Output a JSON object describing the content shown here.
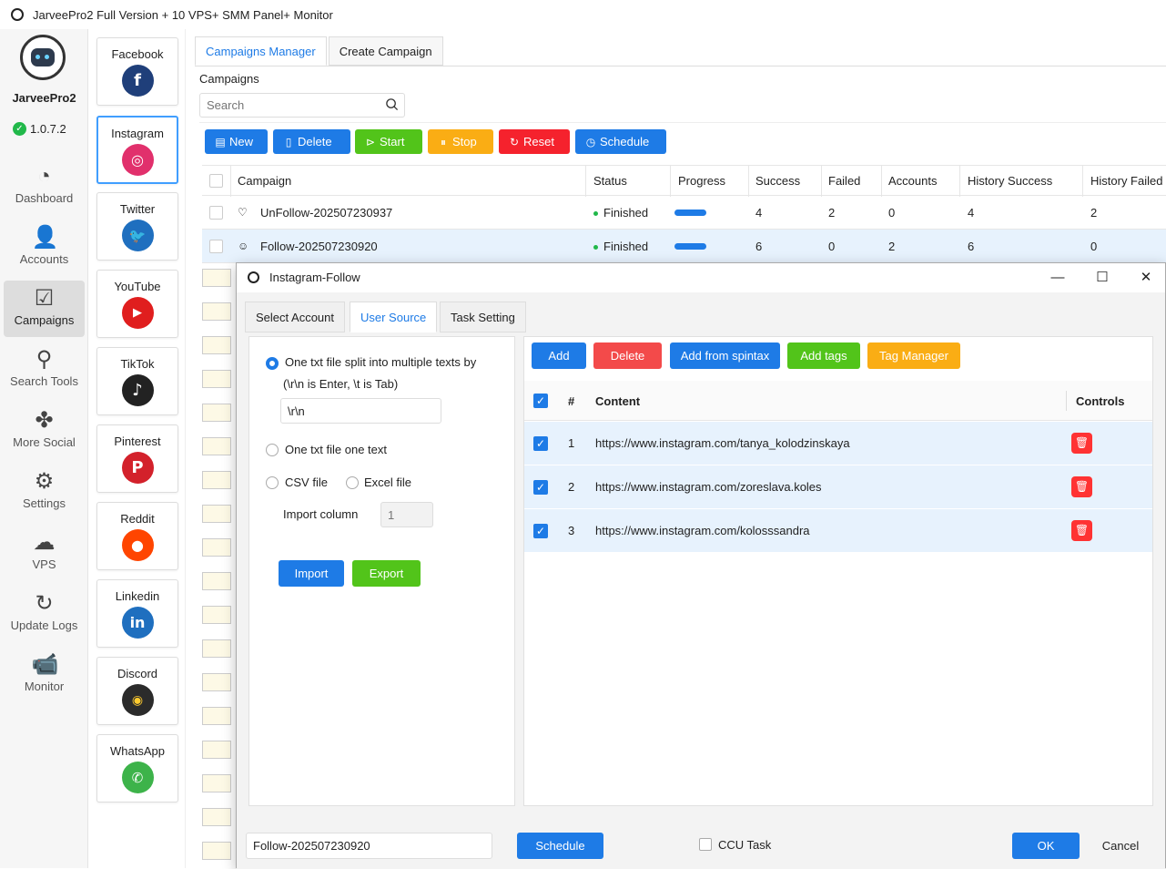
{
  "window": {
    "title": "JarveePro2 Full Version + 10 VPS+ SMM Panel+ Monitor"
  },
  "sidebar": {
    "brand": "JarveePro2",
    "version": "1.0.7.2",
    "items": [
      {
        "label": "Dashboard",
        "icon": "dashboard-icon"
      },
      {
        "label": "Accounts",
        "icon": "accounts-icon"
      },
      {
        "label": "Campaigns",
        "icon": "campaigns-icon",
        "active": true
      },
      {
        "label": "Search Tools",
        "icon": "search-tools-icon"
      },
      {
        "label": "More Social",
        "icon": "more-social-icon"
      },
      {
        "label": "Settings",
        "icon": "gear-icon"
      },
      {
        "label": "VPS",
        "icon": "vps-icon"
      },
      {
        "label": "Update Logs",
        "icon": "update-logs-icon"
      },
      {
        "label": "Monitor",
        "icon": "monitor-icon"
      }
    ]
  },
  "social": [
    {
      "label": "Facebook",
      "icon": "facebook-icon",
      "color": "#1f3f7a"
    },
    {
      "label": "Instagram",
      "icon": "instagram-icon",
      "color": "#e1306c",
      "active": true
    },
    {
      "label": "Twitter",
      "icon": "twitter-icon",
      "color": "#1f6fbf"
    },
    {
      "label": "YouTube",
      "icon": "youtube-icon",
      "color": "#e01e1e"
    },
    {
      "label": "TikTok",
      "icon": "tiktok-icon",
      "color": "#222222"
    },
    {
      "label": "Pinterest",
      "icon": "pinterest-icon",
      "color": "#d3212b"
    },
    {
      "label": "Reddit",
      "icon": "reddit-icon",
      "color": "#ff4500"
    },
    {
      "label": "Linkedin",
      "icon": "linkedin-icon",
      "color": "#1f6fbf"
    },
    {
      "label": "Discord",
      "icon": "discord-icon",
      "color": "#2b2b2b"
    },
    {
      "label": "WhatsApp",
      "icon": "whatsapp-icon",
      "color": "#3db34a"
    }
  ],
  "main": {
    "tabs": [
      "Campaigns Manager",
      "Create Campaign"
    ],
    "section_label": "Campaigns",
    "search_placeholder": "Search",
    "toolbar": [
      {
        "label": "New",
        "color": "#1e7be6",
        "icon": "new-icon"
      },
      {
        "label": "Delete",
        "color": "#1e7be6",
        "icon": "delete-file-icon"
      },
      {
        "label": "Start",
        "color": "#52c41a",
        "icon": "play-icon"
      },
      {
        "label": "Stop",
        "color": "#faad14",
        "icon": "pause-icon"
      },
      {
        "label": "Reset",
        "color": "#f5222d",
        "icon": "reset-icon"
      },
      {
        "label": "Schedule",
        "color": "#1e7be6",
        "icon": "clock-icon"
      }
    ],
    "table": {
      "columns": [
        "Campaign",
        "Status",
        "Progress",
        "Success",
        "Failed",
        "Accounts",
        "History Success",
        "History Failed"
      ],
      "rows": [
        {
          "campaign": "UnFollow-202507230937",
          "status": "Finished",
          "progress": 1.0,
          "success": "4",
          "failed": "2",
          "accounts": "0",
          "history_success": "4",
          "history_failed": "2"
        },
        {
          "campaign": "Follow-202507230920",
          "status": "Finished",
          "progress": 1.0,
          "success": "6",
          "failed": "0",
          "accounts": "2",
          "history_success": "6",
          "history_failed": "0",
          "selected": true
        }
      ]
    }
  },
  "dialog": {
    "title": "Instagram-Follow",
    "tabs": [
      "Select Account",
      "User Source",
      "Task Setting"
    ],
    "active_tab": "User Source",
    "source": {
      "option1_label": "One txt file split into multiple texts by",
      "option1_hint": "(\\r\\n is Enter, \\t is Tab)",
      "separator_value": "\\r\\n",
      "option2_label": "One txt file one text",
      "csv_label": "CSV file",
      "excel_label": "Excel file",
      "import_column_label": "Import column",
      "import_column_placeholder": "1",
      "import_button": "Import",
      "export_button": "Export"
    },
    "user_toolbar": [
      {
        "label": "Add",
        "color": "#1e7be6"
      },
      {
        "label": "Delete",
        "color": "#f34a4a"
      },
      {
        "label": "Add from spintax",
        "color": "#1e7be6"
      },
      {
        "label": "Add tags",
        "color": "#52c41a"
      },
      {
        "label": "Tag Manager",
        "color": "#faad14"
      }
    ],
    "list": {
      "columns": {
        "num": "#",
        "content": "Content",
        "controls": "Controls"
      },
      "rows": [
        {
          "num": "1",
          "content": "https://www.instagram.com/tanya_kolodzinskaya"
        },
        {
          "num": "2",
          "content": "https://www.instagram.com/zoreslava.koles"
        },
        {
          "num": "3",
          "content": "https://www.instagram.com/kolosssandra"
        }
      ]
    },
    "footer": {
      "campaign_name": "Follow-202507230920",
      "schedule_button": "Schedule",
      "ccu_label": "CCU Task",
      "ok_button": "OK",
      "cancel_button": "Cancel"
    }
  }
}
